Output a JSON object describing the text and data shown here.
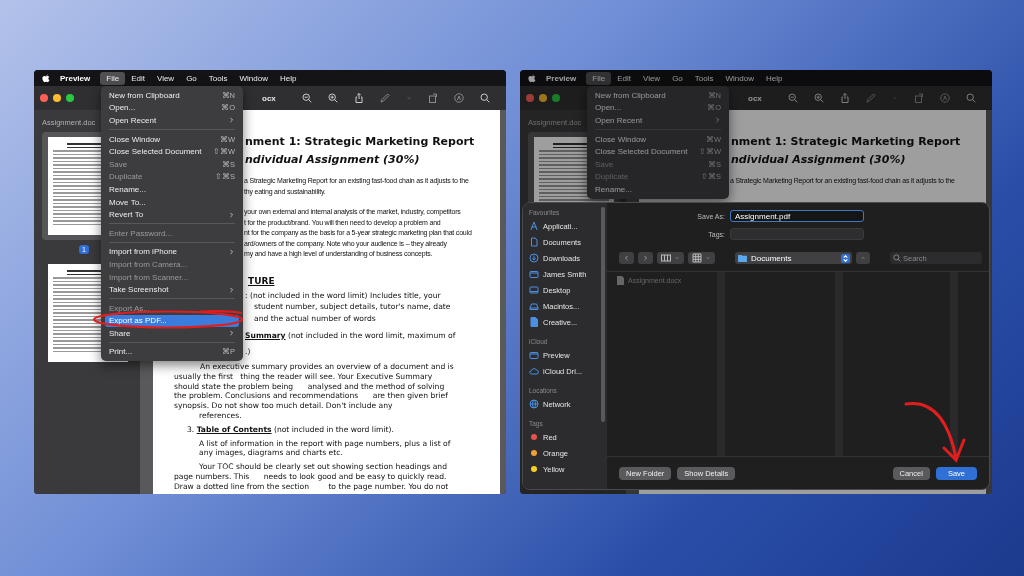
{
  "left_screen": {
    "menu_bar": {
      "app_name": "Preview",
      "menus": [
        {
          "label": "File",
          "selected": true
        },
        {
          "label": "Edit",
          "selected": false
        },
        {
          "label": "View",
          "selected": false
        },
        {
          "label": "Go",
          "selected": false
        },
        {
          "label": "Tools",
          "selected": false
        },
        {
          "label": "Window",
          "selected": false
        },
        {
          "label": "Help",
          "selected": false
        }
      ]
    },
    "window": {
      "title": "ocx",
      "sidebar_title": "Assignment.doc"
    },
    "thumbnails": [
      {
        "selected": true,
        "badge": "1"
      },
      {
        "selected": false
      }
    ],
    "file_menu": [
      {
        "kind": "item",
        "label": "New from Clipboard",
        "shortcut": "⌘N",
        "submenu": false,
        "disabled": false,
        "selected": false
      },
      {
        "kind": "item",
        "label": "Open...",
        "shortcut": "⌘O",
        "submenu": false,
        "disabled": false,
        "selected": false
      },
      {
        "kind": "item",
        "label": "Open Recent",
        "submenu": true,
        "disabled": false,
        "selected": false
      },
      {
        "kind": "separator"
      },
      {
        "kind": "item",
        "label": "Close Window",
        "shortcut": "⌘W",
        "submenu": false,
        "disabled": false,
        "selected": false
      },
      {
        "kind": "item",
        "label": "Close Selected Document",
        "shortcut": "⇧⌘W",
        "submenu": false,
        "disabled": false,
        "selected": false
      },
      {
        "kind": "item",
        "label": "Save",
        "shortcut": "⌘S",
        "submenu": false,
        "disabled": true,
        "selected": false
      },
      {
        "kind": "item",
        "label": "Duplicate",
        "shortcut": "⇧⌘S",
        "submenu": false,
        "disabled": true,
        "selected": false
      },
      {
        "kind": "item",
        "label": "Rename...",
        "submenu": false,
        "disabled": false,
        "selected": false
      },
      {
        "kind": "item",
        "label": "Move To...",
        "submenu": false,
        "disabled": false,
        "selected": false
      },
      {
        "kind": "item",
        "label": "Revert To",
        "submenu": true,
        "disabled": false,
        "selected": false
      },
      {
        "kind": "separator"
      },
      {
        "kind": "item",
        "label": "Enter Password...",
        "submenu": false,
        "disabled": true,
        "selected": false
      },
      {
        "kind": "separator"
      },
      {
        "kind": "item",
        "label": "Import from iPhone",
        "submenu": true,
        "disabled": false,
        "selected": false
      },
      {
        "kind": "item",
        "label": "Import from Camera...",
        "submenu": false,
        "disabled": true,
        "selected": false
      },
      {
        "kind": "item",
        "label": "Import from Scanner...",
        "submenu": false,
        "disabled": true,
        "selected": false
      },
      {
        "kind": "item",
        "label": "Take Screenshot",
        "submenu": true,
        "disabled": false,
        "selected": false
      },
      {
        "kind": "separator"
      },
      {
        "kind": "item",
        "label": "Export As...",
        "submenu": false,
        "disabled": true,
        "selected": false
      },
      {
        "kind": "item",
        "label": "Export as PDF...",
        "submenu": false,
        "disabled": false,
        "selected": true
      },
      {
        "kind": "item",
        "label": "Share",
        "submenu": true,
        "disabled": false,
        "selected": false
      },
      {
        "kind": "separator"
      },
      {
        "kind": "item",
        "label": "Print...",
        "shortcut": "⌘P",
        "submenu": false,
        "disabled": false,
        "selected": false
      }
    ],
    "document": [
      {
        "kind": "heading",
        "text": "nment 1: Strategic Marketing Report"
      },
      {
        "kind": "subheading",
        "text": "ndividual Assignment (30%)"
      },
      {
        "kind": "para",
        "text": "a Strategic Marketing Report for an existing fast-food chain as it adjusts to the"
      },
      {
        "kind": "line",
        "text": "thy eating and sustainability."
      },
      {
        "kind": "para",
        "text": "your own external and internal analysis of the market, industry, competitors"
      },
      {
        "kind": "line",
        "text": "t for the product/brand. You will then need to develop a problem and"
      },
      {
        "kind": "line",
        "text": "nt for the company as the basis for a 5-year strategic marketing plan that could"
      },
      {
        "kind": "line",
        "text": "ard/owners of the company. Note who your audience is – they already"
      },
      {
        "kind": "line",
        "text": "my and have a high level of understanding of business concepts."
      },
      {
        "kind": "section",
        "text": "TURE"
      },
      {
        "kind": "item",
        "text": ": (not included in the word limit) Includes title, your"
      },
      {
        "kind": "item_cont",
        "text": "student number, subject details, tutor's name, date"
      },
      {
        "kind": "item_cont",
        "text": "and the actual number of words"
      },
      {
        "kind": "item_gap",
        "text": "**Summary** (not included in the word limit, maximum of"
      },
      {
        "kind": "item",
        "text": ".)"
      },
      {
        "kind": "indent",
        "text": "An executive summary provides an overview of a document and is"
      },
      {
        "kind": "wrap",
        "text": "usually the first   thing the reader will see. Your Executive Summary"
      },
      {
        "kind": "wrap",
        "text": "should state the problem being      analysed and the method of solving"
      },
      {
        "kind": "wrap",
        "text": "the problem. Conclusions and recommendations      are then given brief"
      },
      {
        "kind": "wrap",
        "text": "synopsis. Do not show too much detail. Don't include any"
      },
      {
        "kind": "sub",
        "text": "references."
      },
      {
        "kind": "numbered",
        "text": "3. **Table of Contents** (not included in the word limit)."
      },
      {
        "kind": "sub_gap",
        "text": "A list of information in the report with page numbers, plus a list of"
      },
      {
        "kind": "sub",
        "text": "any images, diagrams and charts etc."
      },
      {
        "kind": "sub_gap",
        "text": "Your TOC should be clearly set out showing section headings and"
      },
      {
        "kind": "wrap",
        "text": "page numbers. This      needs to look good and be easy to quickly read."
      },
      {
        "kind": "wrap",
        "text": "Draw a dotted line from the section        to the page number. You do not"
      }
    ]
  },
  "right_screen": {
    "menu_bar": {
      "app_name": "Preview",
      "menus": [
        {
          "label": "File",
          "selected": true
        },
        {
          "label": "Edit",
          "selected": false
        },
        {
          "label": "View",
          "selected": false
        },
        {
          "label": "Go",
          "selected": false
        },
        {
          "label": "Tools",
          "selected": false
        },
        {
          "label": "Window",
          "selected": false
        },
        {
          "label": "Help",
          "selected": false
        }
      ]
    },
    "window": {
      "title": "ocx",
      "sidebar_title": "Assignment.doc"
    },
    "thumbnails": [
      {
        "selected": true
      }
    ],
    "file_menu": [
      {
        "kind": "item",
        "label": "New from Clipboard",
        "shortcut": "⌘N",
        "submenu": false,
        "disabled": false,
        "selected": false
      },
      {
        "kind": "item",
        "label": "Open...",
        "shortcut": "⌘O",
        "submenu": false,
        "disabled": false,
        "selected": false
      },
      {
        "kind": "item",
        "label": "Open Recent",
        "submenu": true,
        "disabled": false,
        "selected": false
      },
      {
        "kind": "separator"
      },
      {
        "kind": "item",
        "label": "Close Window",
        "shortcut": "⌘W",
        "submenu": false,
        "disabled": false,
        "selected": false
      },
      {
        "kind": "item",
        "label": "Close Selected Document",
        "shortcut": "⇧⌘W",
        "submenu": false,
        "disabled": false,
        "selected": false
      },
      {
        "kind": "item",
        "label": "Save",
        "shortcut": "⌘S",
        "submenu": false,
        "disabled": true,
        "selected": false
      },
      {
        "kind": "item",
        "label": "Duplicate",
        "shortcut": "⇧⌘S",
        "submenu": false,
        "disabled": true,
        "selected": false
      },
      {
        "kind": "item",
        "label": "Rename...",
        "submenu": false,
        "disabled": false,
        "selected": false
      }
    ],
    "document": [
      {
        "kind": "heading",
        "text": "nment 1: Strategic Marketing Report"
      },
      {
        "kind": "subheading",
        "text": "ndividual Assignment (30%)"
      },
      {
        "kind": "para",
        "text": "a Strategic Marketing Report for an existing fast-food chain as it adjusts to the"
      }
    ],
    "save_dialog": {
      "sidebar": [
        {
          "heading": "Favourites",
          "items": [
            {
              "kind": "apps",
              "label": "Applicati..."
            },
            {
              "kind": "document",
              "label": "Documents"
            },
            {
              "kind": "download",
              "label": "Downloads"
            },
            {
              "kind": "home",
              "label": "James Smith"
            },
            {
              "kind": "desktop",
              "label": "Desktop"
            },
            {
              "kind": "disk",
              "label": "Macintos..."
            },
            {
              "kind": "file",
              "label": "Creative..."
            }
          ]
        },
        {
          "heading": "iCloud",
          "items": [
            {
              "kind": "folder",
              "label": "Preview"
            },
            {
              "kind": "cloud",
              "label": "iCloud Dri..."
            }
          ]
        },
        {
          "heading": "Locations",
          "items": [
            {
              "kind": "network",
              "label": "Network"
            }
          ]
        },
        {
          "heading": "Tags",
          "items": [
            {
              "kind": "tag",
              "label": "Red",
              "color": "#e5534b"
            },
            {
              "kind": "tag",
              "label": "Orange",
              "color": "#f0a030"
            },
            {
              "kind": "tag",
              "label": "Yellow",
              "color": "#f5d020"
            }
          ]
        }
      ],
      "save_as_label": "Save As:",
      "save_as_value": "Assignment.pdf",
      "tags_label": "Tags:",
      "location": "Documents",
      "search_placeholder": "Search",
      "files": [
        {
          "name": "Assignment.docx",
          "disabled": true
        }
      ],
      "buttons": [
        {
          "label": "New Folder",
          "kind": "secondary"
        },
        {
          "label": "Show Details",
          "kind": "secondary"
        },
        {
          "label": "Cancel",
          "kind": "cancel"
        },
        {
          "label": "Save",
          "kind": "primary"
        }
      ]
    }
  }
}
